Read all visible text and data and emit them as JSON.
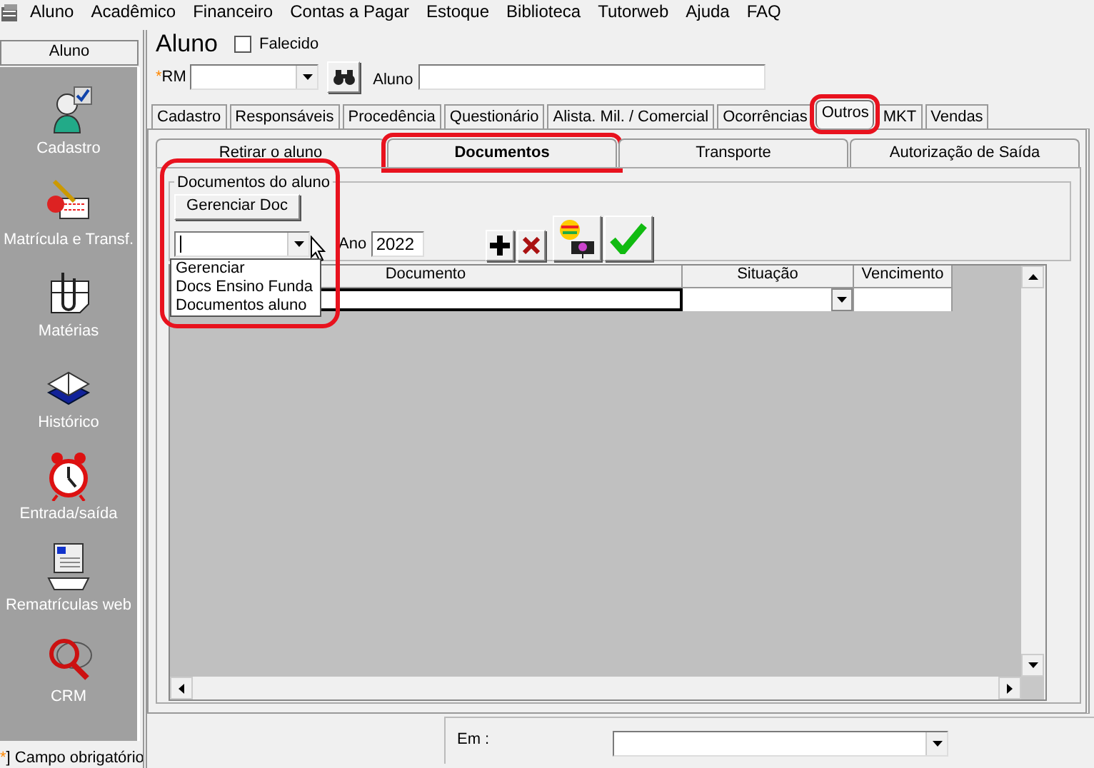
{
  "menu": [
    {
      "label": "Aluno"
    },
    {
      "label": "Acadêmico"
    },
    {
      "label": "Financeiro"
    },
    {
      "label": "Contas a Pagar"
    },
    {
      "label": "Estoque"
    },
    {
      "label": "Biblioteca"
    },
    {
      "label": "Tutorweb"
    },
    {
      "label": "Ajuda"
    },
    {
      "label": "FAQ"
    }
  ],
  "sidebar": {
    "header": "Aluno",
    "items": [
      {
        "label": "Cadastro",
        "kind": "person"
      },
      {
        "label": "Matrícula e Transf.",
        "kind": "signing"
      },
      {
        "label": "Matérias",
        "kind": "clip"
      },
      {
        "label": "Histórico",
        "kind": "book"
      },
      {
        "label": "Entrada/saída",
        "kind": "clock"
      },
      {
        "label": "Rematrículas web",
        "kind": "printer"
      },
      {
        "label": "CRM",
        "kind": "magnifier"
      }
    ]
  },
  "footer_note": {
    "mark": "*",
    "text": "] Campo obrigatório"
  },
  "form": {
    "title": "Aluno",
    "deceased": {
      "label": "Falecido",
      "checked": false
    },
    "rm": {
      "required_mark": "*",
      "label": "RM"
    },
    "student_label": "Aluno"
  },
  "tabs": [
    {
      "label": "Cadastro",
      "selected": false,
      "highlighted": false
    },
    {
      "label": "Responsáveis",
      "selected": false,
      "highlighted": false
    },
    {
      "label": "Procedência",
      "selected": false,
      "highlighted": false
    },
    {
      "label": "Questionário",
      "selected": false,
      "highlighted": false
    },
    {
      "label": "Alista. Mil. / Comercial",
      "selected": false,
      "highlighted": false
    },
    {
      "label": "Ocorrências",
      "selected": false,
      "highlighted": false
    },
    {
      "label": "Outros",
      "selected": true,
      "highlighted": true
    },
    {
      "label": "MKT",
      "selected": false,
      "highlighted": false
    },
    {
      "label": "Vendas",
      "selected": false,
      "highlighted": false
    }
  ],
  "subtabs": [
    {
      "label": "Retirar o aluno",
      "selected": false,
      "highlighted": false
    },
    {
      "label": "Documentos",
      "selected": true,
      "highlighted": true
    },
    {
      "label": "Transporte",
      "selected": false,
      "highlighted": false
    },
    {
      "label": "Autorização de Saída",
      "selected": false,
      "highlighted": false
    }
  ],
  "documents": {
    "group_title": "Documentos do aluno",
    "manage_button": "Gerenciar Doc",
    "highlighted": true,
    "type_dropdown": {
      "expanded": true,
      "options": [
        "Gerenciar",
        "Docs Ensino Funda",
        "Documentos aluno"
      ]
    },
    "year_label": "Ano",
    "year": "2022"
  },
  "grid": {
    "columns": [
      "Documento",
      "Situação",
      "Vencimento"
    ]
  },
  "bottom": {
    "label": "Em :"
  }
}
